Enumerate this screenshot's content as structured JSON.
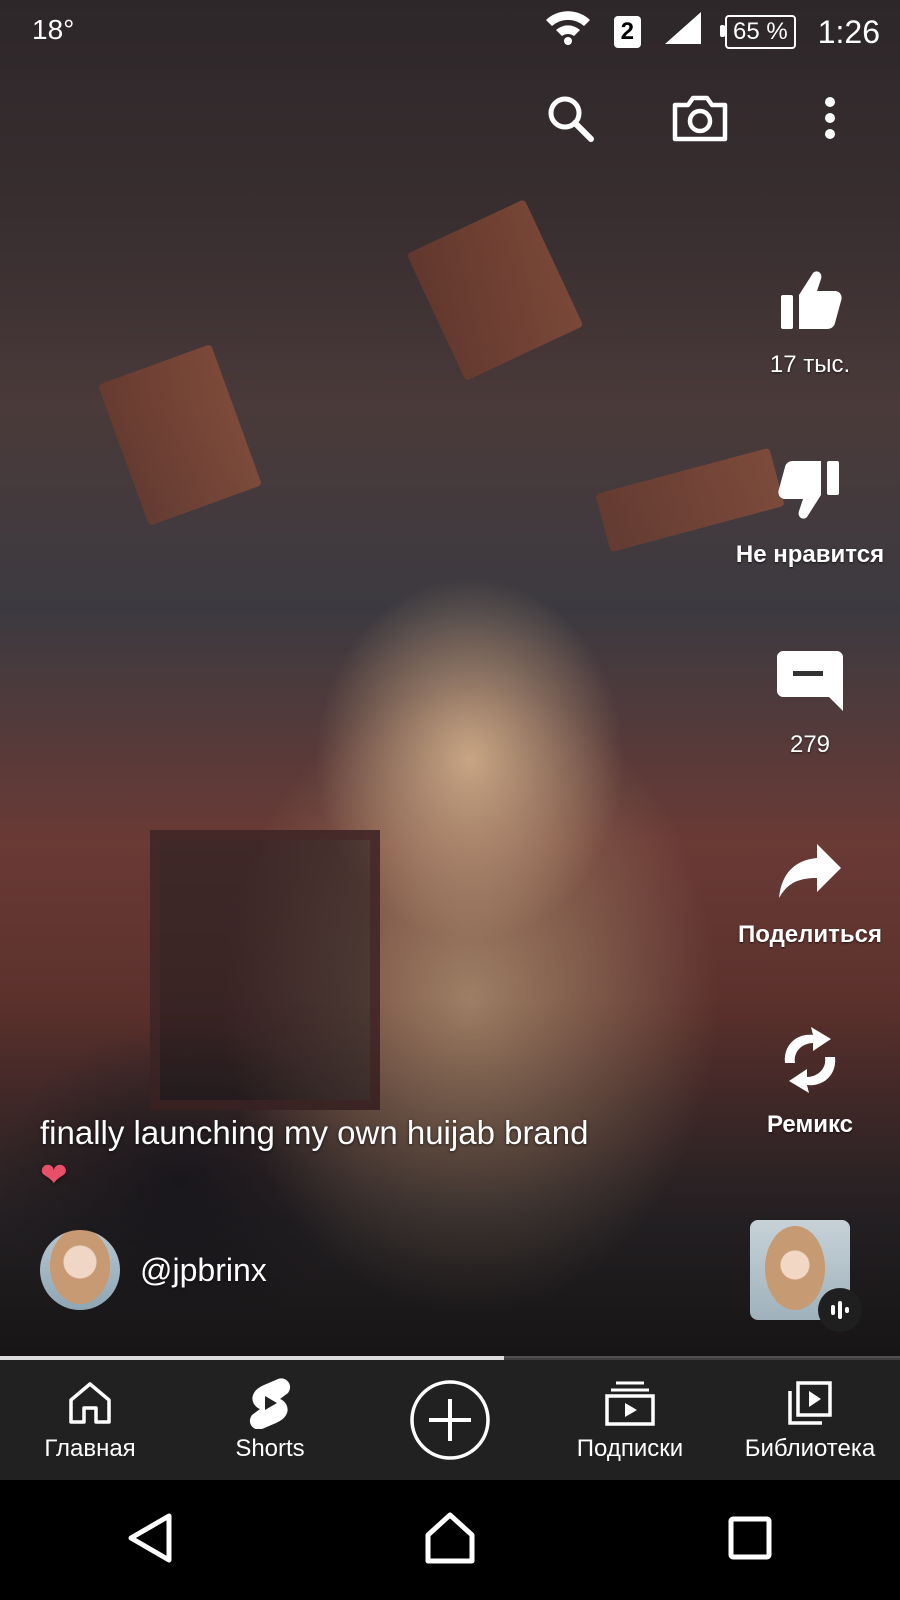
{
  "status_bar": {
    "temperature": "18°",
    "sim_slot": "2",
    "battery": "65 %",
    "time": "1:26"
  },
  "top_actions": {
    "icons": [
      "search-icon",
      "camera-icon",
      "more-vert-icon"
    ]
  },
  "actions": {
    "like": "17 тыс.",
    "dislike": "Не нравится",
    "comments": "279",
    "share": "Поделиться",
    "remix": "Ремикс"
  },
  "video": {
    "caption_line1": "finally launching my own huijab brand",
    "caption_line2": "❤",
    "channel_handle": "@jpbrinx",
    "progress": 0.56
  },
  "bottom_nav": {
    "home": "Главная",
    "shorts": "Shorts",
    "subscriptions": "Подписки",
    "library": "Библиотека"
  },
  "colors": {
    "nav_background": "#212121",
    "accent_heart": "#e8506a"
  }
}
